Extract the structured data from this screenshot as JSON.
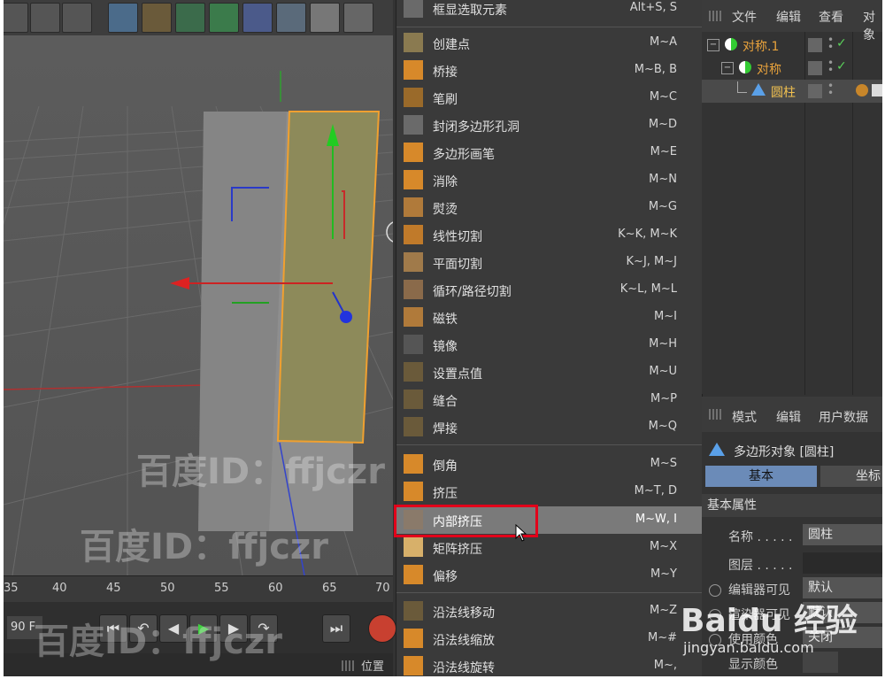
{
  "colors": {
    "menu_bg": "#3a3a3a",
    "menu_highlight": "#7a7a7a",
    "annotation_red": "#e2001a",
    "object_orange": "#e8a23c",
    "tab_active": "#6b8bb8",
    "selection_fill": "#8d8a5a",
    "selection_outline": "#f0a030"
  },
  "toolbar": {
    "icons": [
      "render-view-icon",
      "render-to-picture-viewer-icon",
      "render-settings-icon",
      "cube-icon",
      "pen-icon",
      "subdivision-icon",
      "array-icon",
      "deformer-icon",
      "floor-icon",
      "camera-icon",
      "light-icon"
    ]
  },
  "timeline": {
    "ruler": [
      "35",
      "40",
      "45",
      "50",
      "55",
      "60",
      "65",
      "70"
    ],
    "frame_field": "90 F"
  },
  "status": {
    "position_label": "位置"
  },
  "menu": {
    "items": [
      {
        "label": "框显选取元素",
        "shortcut": "Alt+S, S",
        "icon": "frame-selected-icon"
      },
      {
        "label": "创建点",
        "shortcut": "M~A",
        "icon": "create-point-icon"
      },
      {
        "label": "桥接",
        "shortcut": "M~B, B",
        "icon": "bridge-icon"
      },
      {
        "label": "笔刷",
        "shortcut": "M~C",
        "icon": "brush-icon"
      },
      {
        "label": "封闭多边形孔洞",
        "shortcut": "M~D",
        "icon": "close-polygon-hole-icon"
      },
      {
        "label": "多边形画笔",
        "shortcut": "M~E",
        "icon": "polygon-pen-icon"
      },
      {
        "label": "消除",
        "shortcut": "M~N",
        "icon": "dissolve-icon"
      },
      {
        "label": "熨烫",
        "shortcut": "M~G",
        "icon": "iron-icon"
      },
      {
        "label": "线性切割",
        "shortcut": "K~K, M~K",
        "icon": "line-cut-icon"
      },
      {
        "label": "平面切割",
        "shortcut": "K~J, M~J",
        "icon": "plane-cut-icon"
      },
      {
        "label": "循环/路径切割",
        "shortcut": "K~L, M~L",
        "icon": "loop-path-cut-icon"
      },
      {
        "label": "磁铁",
        "shortcut": "M~I",
        "icon": "magnet-icon"
      },
      {
        "label": "镜像",
        "shortcut": "M~H",
        "icon": "mirror-icon"
      },
      {
        "label": "设置点值",
        "shortcut": "M~U",
        "icon": "set-point-value-icon"
      },
      {
        "label": "缝合",
        "shortcut": "M~P",
        "icon": "stitch-icon"
      },
      {
        "label": "焊接",
        "shortcut": "M~Q",
        "icon": "weld-icon"
      },
      {
        "label": "倒角",
        "shortcut": "M~S",
        "icon": "bevel-icon"
      },
      {
        "label": "挤压",
        "shortcut": "M~T, D",
        "icon": "extrude-icon"
      },
      {
        "label": "内部挤压",
        "shortcut": "M~W, I",
        "icon": "extrude-inner-icon"
      },
      {
        "label": "矩阵挤压",
        "shortcut": "M~X",
        "icon": "matrix-extrude-icon"
      },
      {
        "label": "偏移",
        "shortcut": "M~Y",
        "icon": "smooth-shift-icon"
      },
      {
        "label": "沿法线移动",
        "shortcut": "M~Z",
        "icon": "normal-move-icon"
      },
      {
        "label": "沿法线缩放",
        "shortcut": "M~#",
        "icon": "normal-scale-icon"
      },
      {
        "label": "沿法线旋转",
        "shortcut": "M~,",
        "icon": "normal-rotate-icon"
      }
    ],
    "highlighted": "内部挤压"
  },
  "object_manager": {
    "header": [
      "文件",
      "编辑",
      "查看",
      "对象"
    ],
    "rows": [
      {
        "name": "对称.1",
        "check": "✓"
      },
      {
        "name": "对称",
        "check": "✓"
      },
      {
        "name": "圆柱",
        "check": ""
      }
    ]
  },
  "attribute_manager": {
    "tabs": [
      "模式",
      "编辑",
      "用户数据"
    ],
    "object_title": "多边形对象 [圆柱]",
    "tab_basic": "基本",
    "tab_coord": "坐标",
    "section": "基本属性",
    "props": [
      {
        "label": "名称 . . . . .",
        "value": "圆柱"
      },
      {
        "label": "图层 . . . . .",
        "value": ""
      },
      {
        "label": "编辑器可见",
        "value": "默认"
      },
      {
        "label": "渲染器可见",
        "value": "默认"
      },
      {
        "label": "使用颜色",
        "value": "关闭"
      },
      {
        "label": "显示颜色",
        "value": ""
      }
    ]
  },
  "watermarks": {
    "baidu_id_1": "百度ID：ffjczr",
    "baidu_id_2": "百度ID：ffjczr",
    "baidu_id_3": "百度ID：ffjczr",
    "baidu_logo": "Baidu 经验",
    "baidu_url": "jingyan.baidu.com"
  }
}
